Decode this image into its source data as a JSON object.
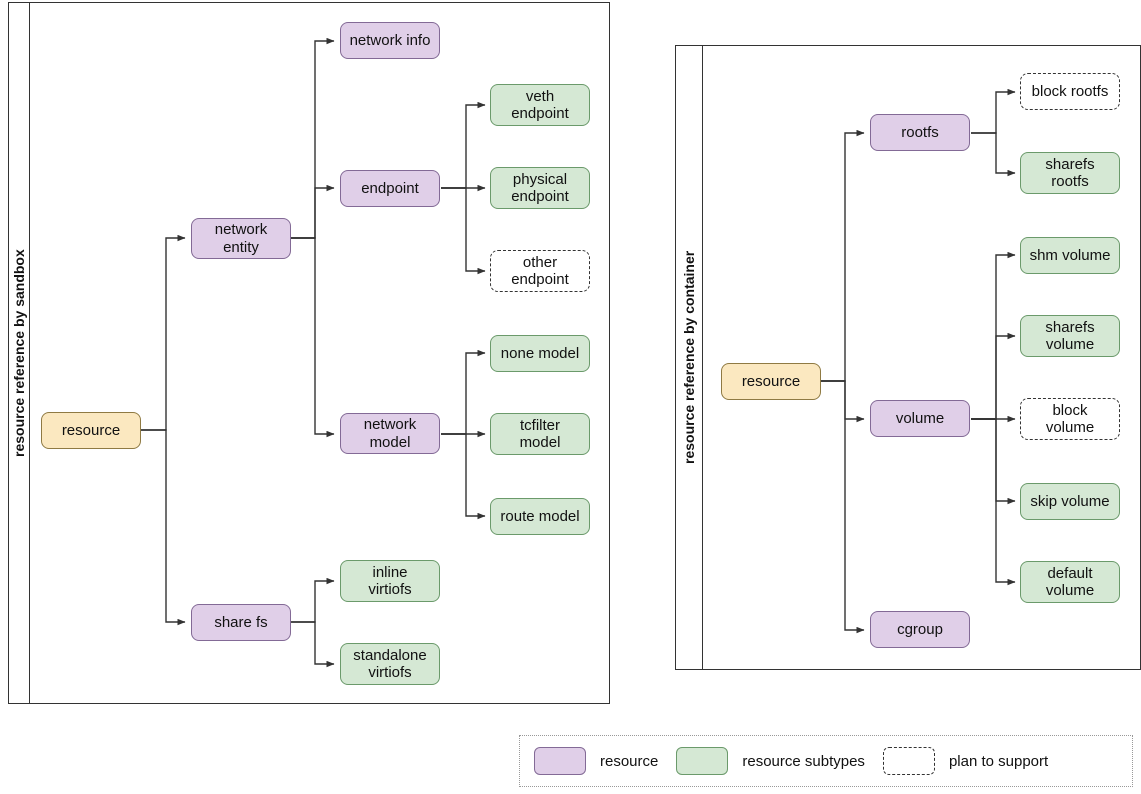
{
  "panels": [
    {
      "id": "sandbox",
      "label": "resource reference by sandbox",
      "root": "resource"
    },
    {
      "id": "container",
      "label": "resource reference by container",
      "root": "resource"
    }
  ],
  "sandbox_nodes": {
    "resource": "resource",
    "network_entity": "network\nentity",
    "share_fs": "share fs",
    "network_info": "network info",
    "endpoint": "endpoint",
    "network_model": "network\nmodel",
    "veth_endpoint": "veth\nendpoint",
    "physical_endpoint": "physical\nendpoint",
    "other_endpoint": "other\nendpoint",
    "none_model": "none model",
    "tcfilter_model": "tcfilter\nmodel",
    "route_model": "route model",
    "inline_virtiofs": "inline\nvirtiofs",
    "standalone_virtiofs": "standalone\nvirtiofs"
  },
  "container_nodes": {
    "resource": "resource",
    "rootfs": "rootfs",
    "volume": "volume",
    "cgroup": "cgroup",
    "block_rootfs": "block rootfs",
    "sharefs_rootfs": "sharefs\nrootfs",
    "shm_volume": "shm volume",
    "sharefs_volume": "sharefs\nvolume",
    "block_volume": "block\nvolume",
    "skip_volume": "skip volume",
    "default_volume": "default\nvolume"
  },
  "legend": [
    {
      "key": "resource",
      "label": "resource",
      "style": "purple"
    },
    {
      "key": "subtypes",
      "label": "resource subtypes",
      "style": "green"
    },
    {
      "key": "plan",
      "label": "plan to support",
      "style": "dashed"
    }
  ],
  "colors": {
    "resource_fill": "#fbe8c0",
    "purple_fill": "#e0cfe8",
    "green_fill": "#d5e8d4",
    "stroke": "#333333"
  }
}
